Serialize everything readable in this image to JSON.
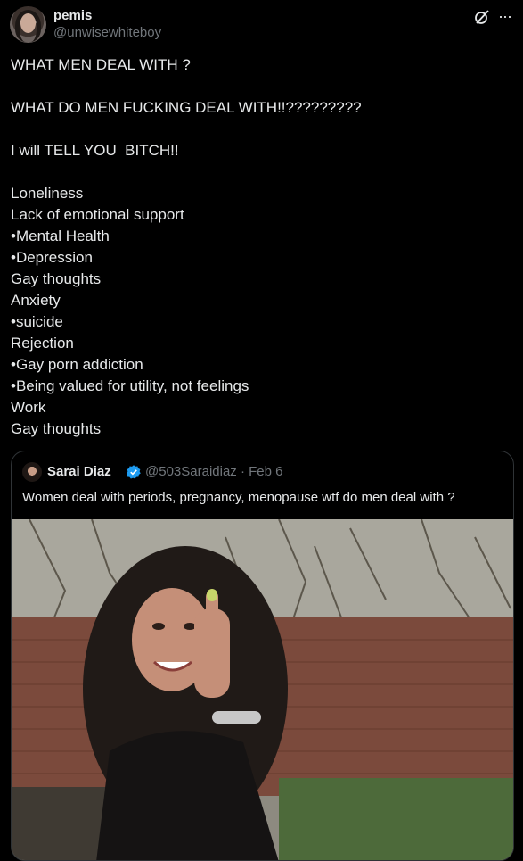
{
  "author": {
    "name": "pemis",
    "handle": "@unwisewhiteboy"
  },
  "tweet": {
    "lines": [
      "WHAT MEN DEAL WITH ?",
      "",
      "WHAT DO MEN FUCKING DEAL WITH!!?????????",
      "",
      "I will TELL YOU  BITCH!!",
      "",
      "Loneliness",
      "Lack of emotional support",
      "•Mental Health",
      "•Depression",
      "Gay thoughts",
      "Anxiety",
      "•suicide",
      "Rejection",
      "•Gay porn addiction",
      "•Being valued for utility, not feelings",
      "Work",
      "Gay thoughts"
    ]
  },
  "quoted": {
    "name": "Sarai Diaz",
    "handle_date": "@503Saraidiaz · Feb 6",
    "text": "Women deal with periods, pregnancy, menopause wtf do men deal with ?"
  },
  "icons": {
    "header_action": "grok-icon",
    "more": "more-icon",
    "badge": "verified-icon"
  },
  "colors": {
    "background": "#000000",
    "text": "#e7e9ea",
    "secondary": "#71767b",
    "border": "#2f3336",
    "verified": "#1d9bf0"
  }
}
